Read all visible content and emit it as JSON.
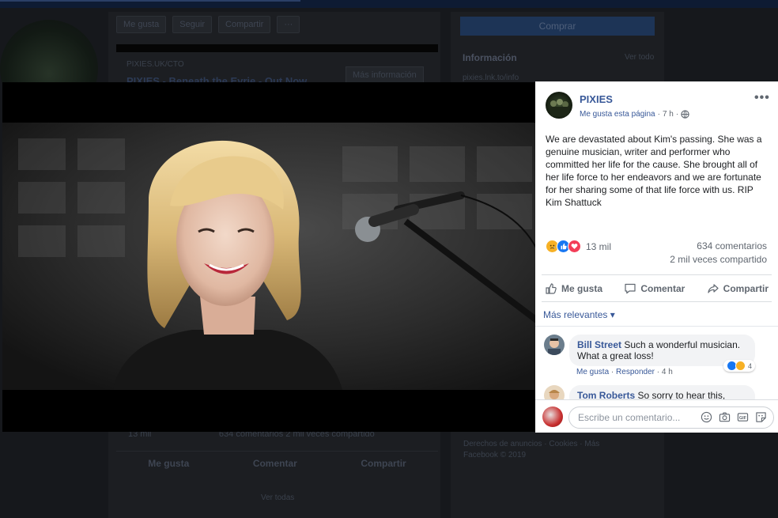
{
  "background": {
    "page_actions": [
      "Me gusta",
      "Seguir",
      "Compartir",
      "···"
    ],
    "source": "PIXIES.UK/CTO",
    "more_info": "Más información",
    "headline": "PIXIES - Beneath the Eyrie - Out Now",
    "buy_button": "Comprar",
    "info_title": "Información",
    "see_all": "Ver todo",
    "info_link": "pixies.lnk.to/info",
    "reactions_bar": "13 mil",
    "comments_shares": "634 comentarios  2 mil veces compartido",
    "like": "Me gusta",
    "comment": "Comentar",
    "share": "Compartir",
    "see_all_bottom": "Ver todas",
    "footer_line1": "Derechos de anuncios · Cookies · Más",
    "footer_line2": "Facebook © 2019"
  },
  "post": {
    "page_name": "PIXIES",
    "meta_liked": "Me gusta esta página",
    "meta_dot": "·",
    "meta_time": "7 h",
    "meta_sep": "·",
    "more_icon": "more-horizontal-icon",
    "text": "We are devastated about Kim's passing. She was a genuine musician, writer and performer who committed her life for the cause. She brought all of her life force to her endeavors and we are fortunate for her sharing some of that life force with us. RIP Kim Shattuck",
    "reactions_count": "13 mil",
    "comments_count": "634 comentarios",
    "shares_count": "2 mil veces compartido",
    "actions": {
      "like": "Me gusta",
      "comment": "Comentar",
      "share": "Compartir"
    },
    "relevance_label": "Más relevantes ▾"
  },
  "comments": [
    {
      "author": "Bill Street",
      "text": "Such a wonderful musician. What a great loss!",
      "like": "Me gusta",
      "sep": "·",
      "reply": "Responder",
      "time": "4 h",
      "reaction_count": "4"
    },
    {
      "author": "Tom Roberts",
      "text": "So sorry to hear this,"
    }
  ],
  "composer": {
    "placeholder": "Escribe un comentario...",
    "icons": [
      "emoji-icon",
      "camera-icon",
      "gif-icon",
      "sticker-icon"
    ]
  },
  "colors": {
    "link_blue": "#385898",
    "like_blue": "#1877f2",
    "love_red": "#f33e58",
    "sad_yellow": "#f7b125"
  }
}
